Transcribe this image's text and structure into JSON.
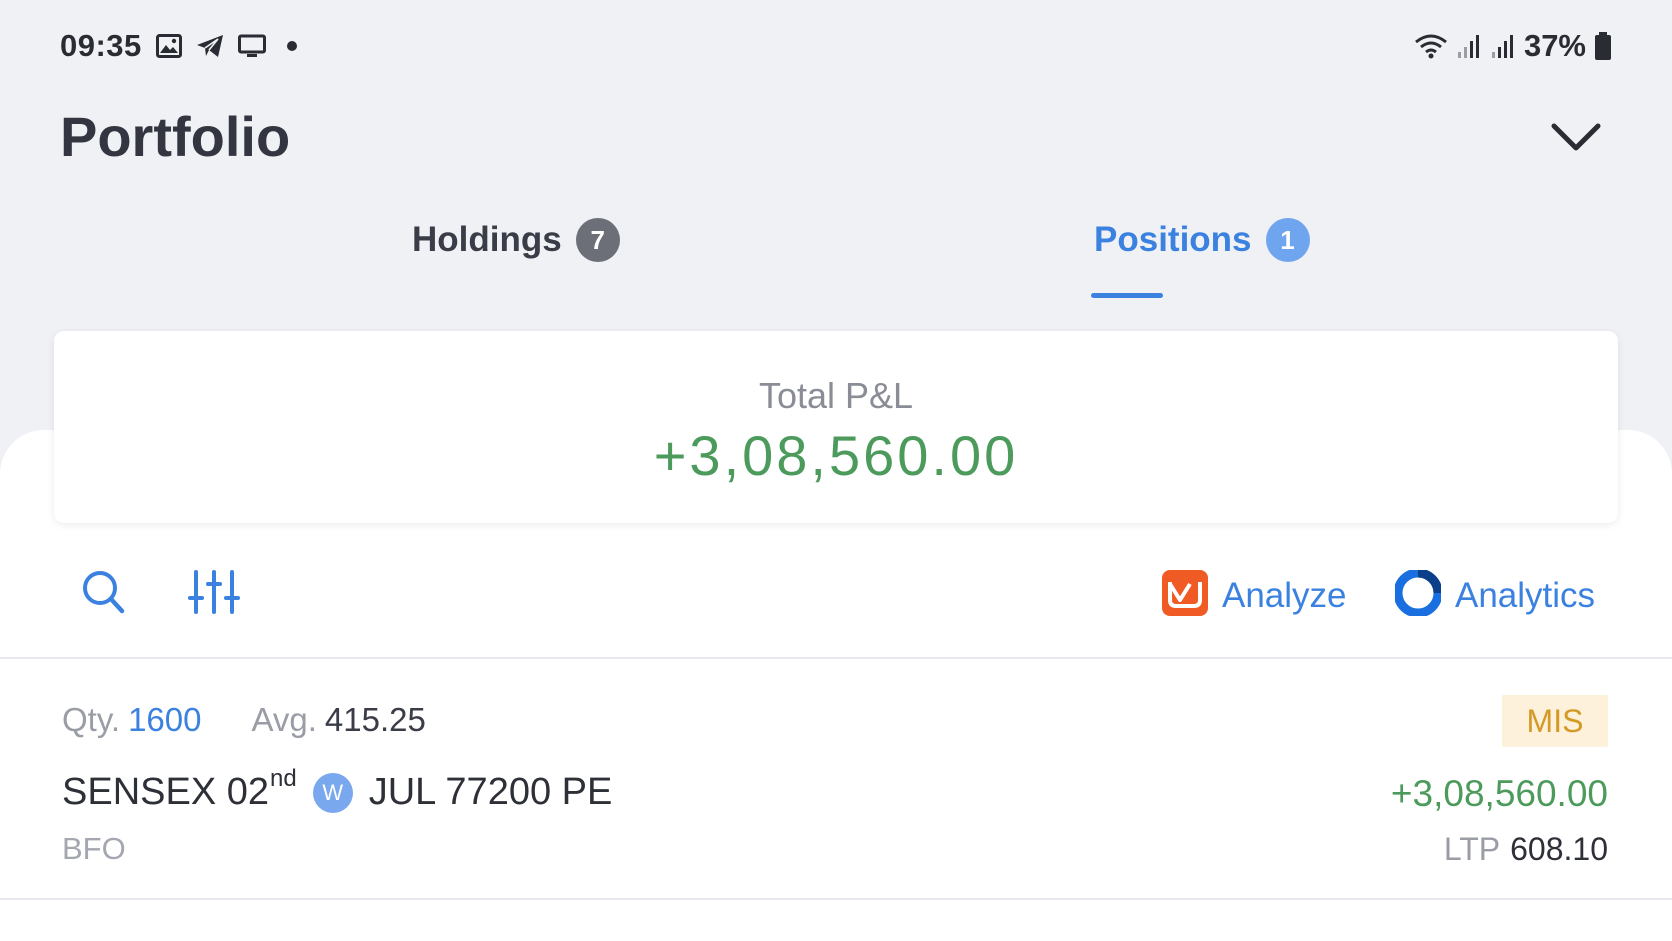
{
  "status_bar": {
    "time": "09:35",
    "battery": "37%",
    "icons": [
      "gallery-icon",
      "telegram-icon",
      "monitor-icon",
      "dot-icon",
      "wifi-icon",
      "signal-icon",
      "signal-icon",
      "battery-icon"
    ]
  },
  "header": {
    "title": "Portfolio"
  },
  "tabs": [
    {
      "label": "Holdings",
      "count": "7",
      "active": false
    },
    {
      "label": "Positions",
      "count": "1",
      "active": true
    }
  ],
  "summary": {
    "label": "Total P&L",
    "value": "+3,08,560.00"
  },
  "toolbar": {
    "analyze_label": "Analyze",
    "analytics_label": "Analytics"
  },
  "positions": [
    {
      "qty_label": "Qty.",
      "qty": "1600",
      "avg_label": "Avg.",
      "avg": "415.25",
      "product": "MIS",
      "symbol_prefix": "SENSEX 02",
      "symbol_suffix": "nd",
      "weekly_badge": "W",
      "symbol_rest": "JUL 77200 PE",
      "exchange": "BFO",
      "pnl": "+3,08,560.00",
      "ltp_label": "LTP",
      "ltp": "608.10"
    }
  ],
  "colors": {
    "accent": "#3b82e0",
    "profit": "#4c9b5d",
    "product_badge_bg": "#fdf1dc",
    "product_badge_text": "#d49a26",
    "analyze_brand": "#f05a24",
    "analytics_brand": "#1a6fe0"
  }
}
